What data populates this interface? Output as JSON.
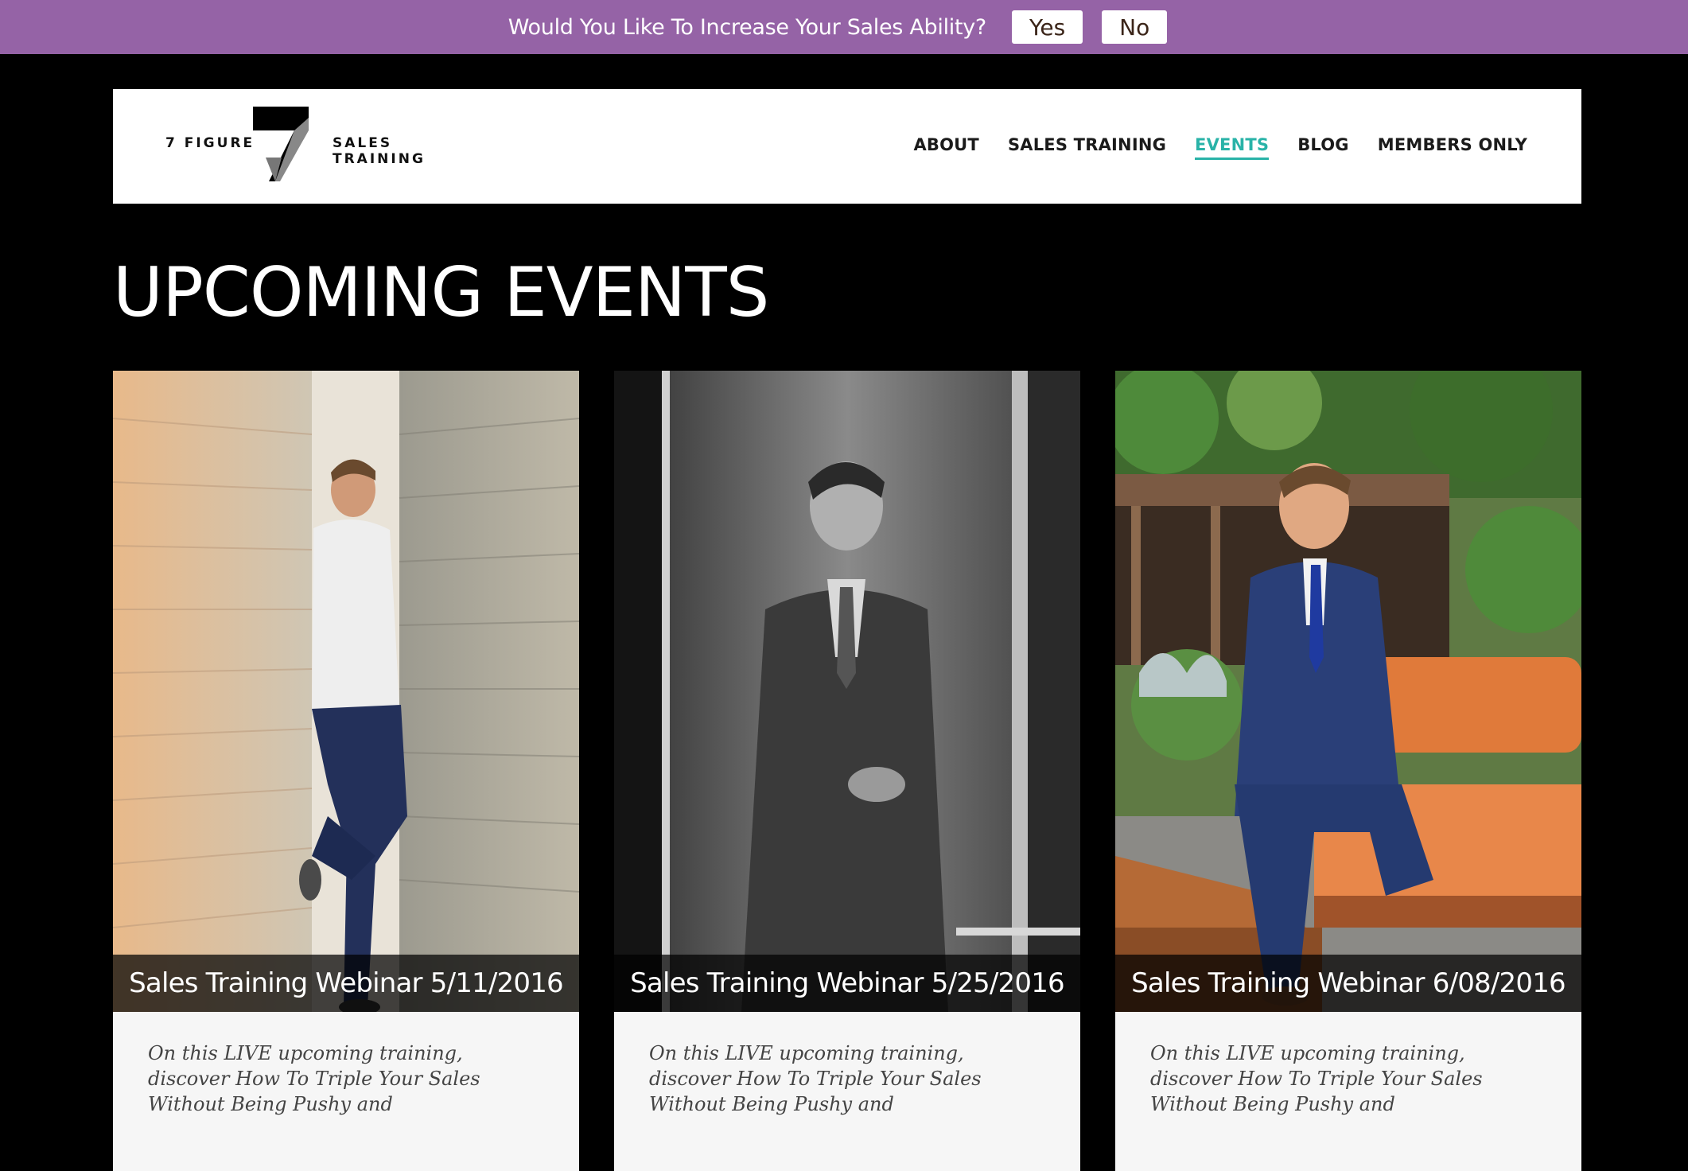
{
  "promo": {
    "question": "Would You Like To Increase Your Sales Ability?",
    "yes_label": "Yes",
    "no_label": "No",
    "bar_color": "#9563a6"
  },
  "header": {
    "logo_left": "7 FIGURE",
    "logo_right": "SALES TRAINING",
    "nav": [
      {
        "label": "ABOUT",
        "active": false
      },
      {
        "label": "SALES TRAINING",
        "active": false
      },
      {
        "label": "EVENTS",
        "active": true
      },
      {
        "label": "BLOG",
        "active": false
      },
      {
        "label": "MEMBERS ONLY",
        "active": false
      }
    ],
    "active_color": "#29b3a8"
  },
  "main": {
    "title": "UPCOMING EVENTS",
    "events": [
      {
        "title": "Sales Training Webinar 5/11/2016",
        "description": "On this LIVE upcoming training, discover How To Triple Your Sales Without Being Pushy and"
      },
      {
        "title": "Sales Training Webinar 5/25/2016",
        "description": "On this LIVE upcoming training, discover How To Triple Your Sales Without Being Pushy and"
      },
      {
        "title": "Sales Training Webinar 6/08/2016",
        "description": "On this LIVE upcoming training, discover How To Triple Your Sales Without Being Pushy and"
      }
    ]
  }
}
